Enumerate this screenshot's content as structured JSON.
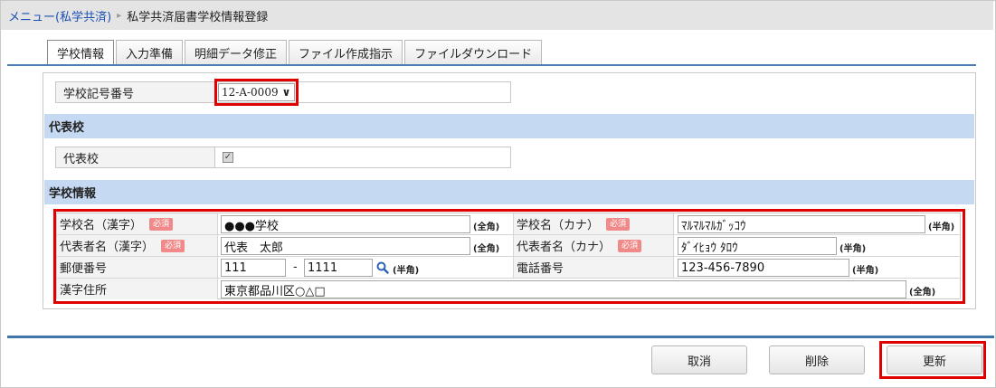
{
  "breadcrumb": {
    "menu_link": "メニュー(私学共済)",
    "current_page": "私学共済届書学校情報登録"
  },
  "tabs": [
    {
      "label": "学校情報",
      "active": true
    },
    {
      "label": "入力準備",
      "active": false
    },
    {
      "label": "明細データ修正",
      "active": false
    },
    {
      "label": "ファイル作成指示",
      "active": false
    },
    {
      "label": "ファイルダウンロード",
      "active": false
    }
  ],
  "school_code": {
    "label": "学校記号番号",
    "selected_value": "12-A-0009"
  },
  "representative_section": {
    "title": "代表校",
    "field_label": "代表校",
    "checked": true
  },
  "school_info_section": {
    "title": "学校情報",
    "required_badge": "必須",
    "fields": {
      "school_name_kanji": {
        "label": "学校名（漢字）",
        "value": "●●●学校",
        "unit": "(全角)"
      },
      "school_name_kana": {
        "label": "学校名（カナ）",
        "value": "ﾏﾙﾏﾙﾏﾙｶﾞｯｺｳ",
        "unit": "(半角)"
      },
      "rep_name_kanji": {
        "label": "代表者名（漢字）",
        "value": "代表　太郎",
        "unit": "(全角)"
      },
      "rep_name_kana": {
        "label": "代表者名（カナ）",
        "value": "ﾀﾞｲﾋｮｳ ﾀﾛｳ",
        "unit": "(半角)"
      },
      "postal_code": {
        "label": "郵便番号",
        "value_1": "111",
        "separator": "-",
        "value_2": "1111",
        "unit": "(半角)"
      },
      "phone": {
        "label": "電話番号",
        "value": "123-456-7890",
        "unit": "(半角)"
      },
      "address": {
        "label": "漢字住所",
        "value": "東京都品川区○△□",
        "unit": "(全角)"
      }
    }
  },
  "buttons": {
    "cancel": "取消",
    "delete": "削除",
    "update": "更新"
  },
  "colors": {
    "section_header_bg": "#c5d9f3",
    "highlight_red": "#e00000",
    "required_badge_bg": "#f08a8a",
    "accent_line": "#3f75a8",
    "link_blue": "#1a4fb3"
  }
}
